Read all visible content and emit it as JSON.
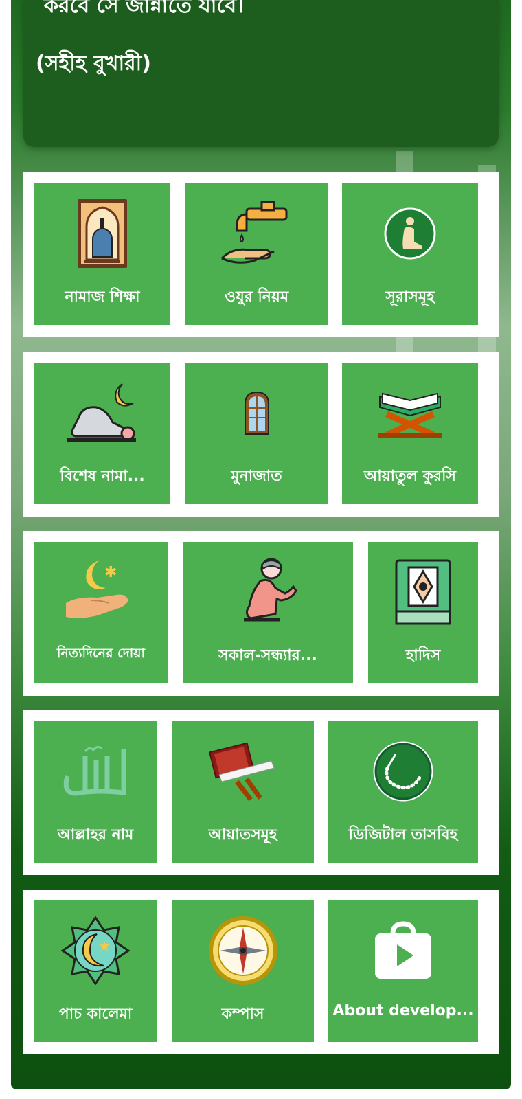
{
  "hadith": {
    "text_line": "করবে সে জান্নাতে যাবে।",
    "source": "(সহীহ বুখারী)"
  },
  "menu": [
    [
      {
        "label": "নামাজ শিক্ষা",
        "icon": "prayer-rug-icon"
      },
      {
        "label": "ওযুর নিয়ম",
        "icon": "water-tap-icon"
      },
      {
        "label": "সূরাসমূহ",
        "icon": "praying-man-badge-icon"
      }
    ],
    [
      {
        "label": "বিশেষ নামা...",
        "icon": "prostration-moon-icon"
      },
      {
        "label": "মুনাজাত",
        "icon": "window-arch-icon"
      },
      {
        "label": "আয়াতুল কুরসি",
        "icon": "quran-stand-icon"
      }
    ],
    [
      {
        "label": "নিত্যদিনের দোয়া",
        "icon": "hand-crescent-icon"
      },
      {
        "label": "সকাল-সন্ধ্যার...",
        "icon": "kneeling-prayer-icon"
      },
      {
        "label": "হাদিস",
        "icon": "book-icon"
      }
    ],
    [
      {
        "label": "আল্লাহর নাম",
        "icon": "allah-calligraphy-icon"
      },
      {
        "label": "আয়াতসমূহ",
        "icon": "open-quran-icon"
      },
      {
        "label": "ডিজিটাল তাসবিহ",
        "icon": "tasbih-beads-icon"
      }
    ],
    [
      {
        "label": "পাচ কালেমা",
        "icon": "crescent-star-badge-icon"
      },
      {
        "label": "কম্পাস",
        "icon": "compass-icon"
      },
      {
        "label": "About develop...",
        "icon": "play-store-icon"
      }
    ]
  ],
  "colors": {
    "tile": "#4caf50",
    "background": "#1d5e1f"
  }
}
